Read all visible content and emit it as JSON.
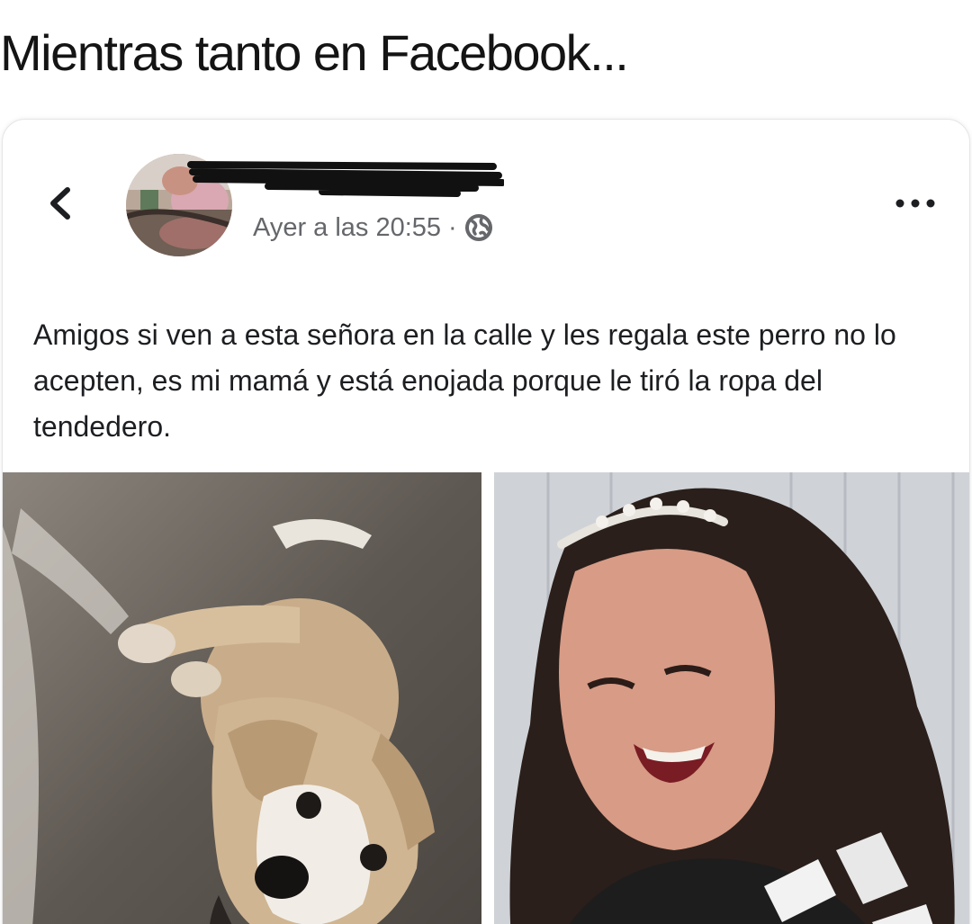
{
  "meme": {
    "title": "Mientras tanto en Facebook..."
  },
  "post": {
    "author_name": "",
    "timestamp": "Ayer a las 20:55",
    "separator": "·",
    "privacy_icon": "globe-icon",
    "back_icon": "chevron-left-icon",
    "more_icon": "more-horizontal-icon",
    "text": "Amigos si ven a esta señora en la calle y les regala este perro no lo acepten, es mi mamá y está enojada porque le tiró la ropa del tendedero.",
    "photos": [
      {
        "subject": "dog-photo"
      },
      {
        "subject": "woman-photo"
      }
    ]
  },
  "colors": {
    "text_primary": "#1c1e21",
    "text_secondary": "#65676b",
    "card_background": "#ffffff",
    "redaction": "#111111"
  }
}
